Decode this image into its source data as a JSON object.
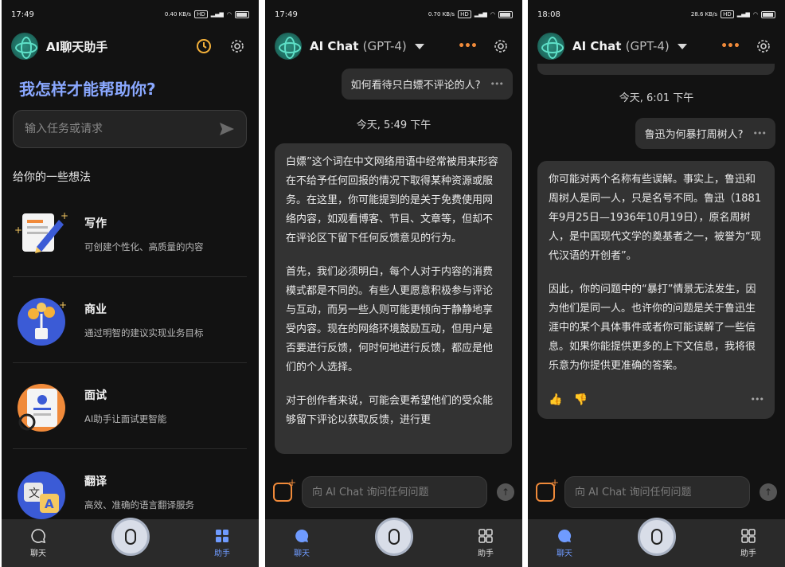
{
  "screens": [
    {
      "status_time": "17:49",
      "status_net": "0.40 KB/s",
      "header_title": "AI聊天助手",
      "headline": "我怎样才能帮助你?",
      "input_placeholder": "输入任务或请求",
      "section_title": "给你的一些想法",
      "features": [
        {
          "title": "写作",
          "desc": "可创建个性化、高质量的内容",
          "icon": "writing-icon"
        },
        {
          "title": "商业",
          "desc": "通过明智的建议实现业务目标",
          "icon": "money-plant-icon"
        },
        {
          "title": "面试",
          "desc": "AI助手让面试更智能",
          "icon": "resume-icon"
        },
        {
          "title": "翻译",
          "desc": "高效、准确的语言翻译服务",
          "icon": "translate-icon"
        }
      ],
      "nav": {
        "chat": "聊天",
        "assistant": "助手"
      }
    },
    {
      "status_time": "17:49",
      "status_net": "0.70 KB/s",
      "header_title": "AI Chat",
      "header_model": "(GPT-4)",
      "user_message": "如何看待只白嫖不评论的人?",
      "timestamp": "今天, 5:49 下午",
      "ai_paragraphs": [
        "白嫖”这个词在中文网络用语中经常被用来形容在不给予任何回报的情况下取得某种资源或服务。在这里，你可能提到的是关于免费使用网络内容，如观看博客、节目、文章等，但却不在评论区下留下任何反馈意见的行为。",
        "首先，我们必须明白，每个人对于内容的消费模式都是不同的。有些人更愿意积极参与评论与互动，而另一些人则可能更倾向于静静地享受内容。现在的网络环境鼓励互动，但用户是否要进行反馈，何时何地进行反馈，都应是他们的个人选择。",
        "对于创作者来说，可能会更希望他们的受众能够留下评论以获取反馈，进行更"
      ],
      "composer_placeholder": "向 AI Chat 询问任何问题",
      "nav": {
        "chat": "聊天",
        "assistant": "助手"
      }
    },
    {
      "status_time": "18:08",
      "status_net": "28.6 KB/s",
      "header_title": "AI Chat",
      "header_model": "(GPT-4)",
      "timestamp": "今天, 6:01 下午",
      "user_message": "鲁迅为何暴打周树人?",
      "ai_paragraphs": [
        "你可能对两个名称有些误解。事实上，鲁迅和周树人是同一人，只是名号不同。鲁迅（1881年9月25日—1936年10月19日），原名周树人，是中国现代文学的奠基者之一，被誉为“现代汉语的开创者”。",
        "因此，你的问题中的“暴打”情景无法发生，因为他们是同一人。也许你的问题是关于鲁迅生涯中的某个具体事件或者你可能误解了一些信息。如果你能提供更多的上下文信息，我将很乐意为你提供更准确的答案。"
      ],
      "composer_placeholder": "向 AI Chat 询问任何问题",
      "nav": {
        "chat": "聊天",
        "assistant": "助手"
      }
    }
  ],
  "colors": {
    "background": "#121212",
    "accent_blue": "#6f9bff",
    "headline": "#8aa8ff",
    "accent_orange": "#f08a3a",
    "bubble": "#333333"
  }
}
